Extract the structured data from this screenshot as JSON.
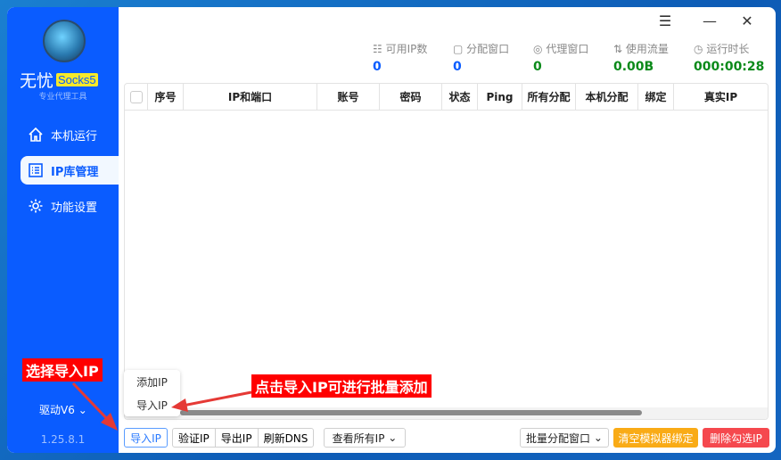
{
  "app": {
    "name": "无忧",
    "tag": "Socks5",
    "subtitle": "专业代理工具",
    "driver": "驱动V6",
    "version": "1.25.8.1"
  },
  "sidebar": {
    "items": [
      {
        "label": "本机运行",
        "icon": "home-icon"
      },
      {
        "label": "IP库管理",
        "icon": "list-icon",
        "active": true
      },
      {
        "label": "功能设置",
        "icon": "gear-icon"
      }
    ]
  },
  "window_controls": {
    "menu": "☰",
    "minimize": "—",
    "close": "✕"
  },
  "stats": [
    {
      "icon": "☷",
      "label": "可用IP数",
      "value": "0",
      "color": "#0a5cff"
    },
    {
      "icon": "▢",
      "label": "分配窗口",
      "value": "0",
      "color": "#0a5cff"
    },
    {
      "icon": "◎",
      "label": "代理窗口",
      "value": "0",
      "color": "#0b8a1a"
    },
    {
      "icon": "⇅",
      "label": "使用流量",
      "value": "0.00B",
      "color": "#0b8a1a"
    },
    {
      "icon": "◷",
      "label": "运行时长",
      "value": "000:00:28",
      "color": "#0b8a1a"
    }
  ],
  "table": {
    "columns": [
      "序号",
      "IP和端口",
      "账号",
      "密码",
      "状态",
      "Ping",
      "所有分配",
      "本机分配",
      "绑定",
      "真实IP"
    ]
  },
  "popup_menu": [
    "添加IP",
    "导入IP"
  ],
  "toolbar": {
    "import": "导入IP",
    "verify": "验证IP",
    "export": "导出IP",
    "refresh_dns": "刷新DNS",
    "view_filter": "查看所有IP",
    "batch_assign": "批量分配窗口",
    "clear_binding": "清空模拟器绑定",
    "delete_selected": "删除勾选IP"
  },
  "annotations": {
    "left": "选择导入IP",
    "right": "点击导入IP可进行批量添加"
  }
}
